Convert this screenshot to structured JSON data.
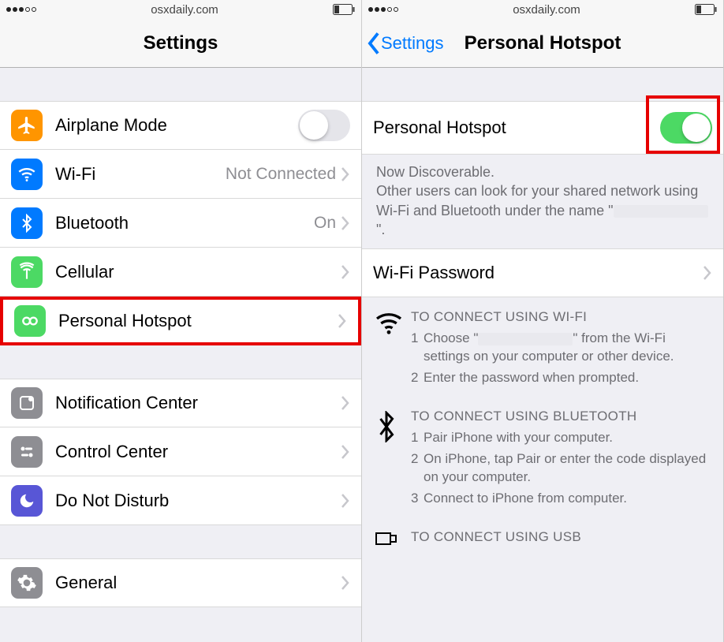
{
  "status_bar": {
    "domain": "osxdaily.com"
  },
  "left": {
    "title": "Settings",
    "rows": {
      "airplane": {
        "label": "Airplane Mode",
        "toggle_on": false
      },
      "wifi": {
        "label": "Wi-Fi",
        "detail": "Not Connected"
      },
      "bluetooth": {
        "label": "Bluetooth",
        "detail": "On"
      },
      "cellular": {
        "label": "Cellular"
      },
      "hotspot": {
        "label": "Personal Hotspot"
      },
      "notif": {
        "label": "Notification Center"
      },
      "control": {
        "label": "Control Center"
      },
      "dnd": {
        "label": "Do Not Disturb"
      },
      "general": {
        "label": "General"
      }
    }
  },
  "right": {
    "back": "Settings",
    "title": "Personal Hotspot",
    "toggle_row": {
      "label": "Personal Hotspot",
      "on": true
    },
    "discover_line": "Now Discoverable.",
    "discover_body_a": "Other users can look for your shared network using Wi-Fi and Bluetooth under the name \"",
    "discover_body_b": "\".",
    "wifi_pw": {
      "label": "Wi-Fi Password"
    },
    "instr_wifi": {
      "title": "TO CONNECT USING WI-FI",
      "s1a": "Choose \"",
      "s1b": "\" from the Wi-Fi settings on your computer or other device.",
      "s2": "Enter the password when prompted."
    },
    "instr_bt": {
      "title": "TO CONNECT USING BLUETOOTH",
      "s1": "Pair iPhone with your computer.",
      "s2": "On iPhone, tap Pair or enter the code displayed on your computer.",
      "s3": "Connect to iPhone from computer."
    },
    "instr_usb": {
      "title": "TO CONNECT USING USB"
    }
  }
}
